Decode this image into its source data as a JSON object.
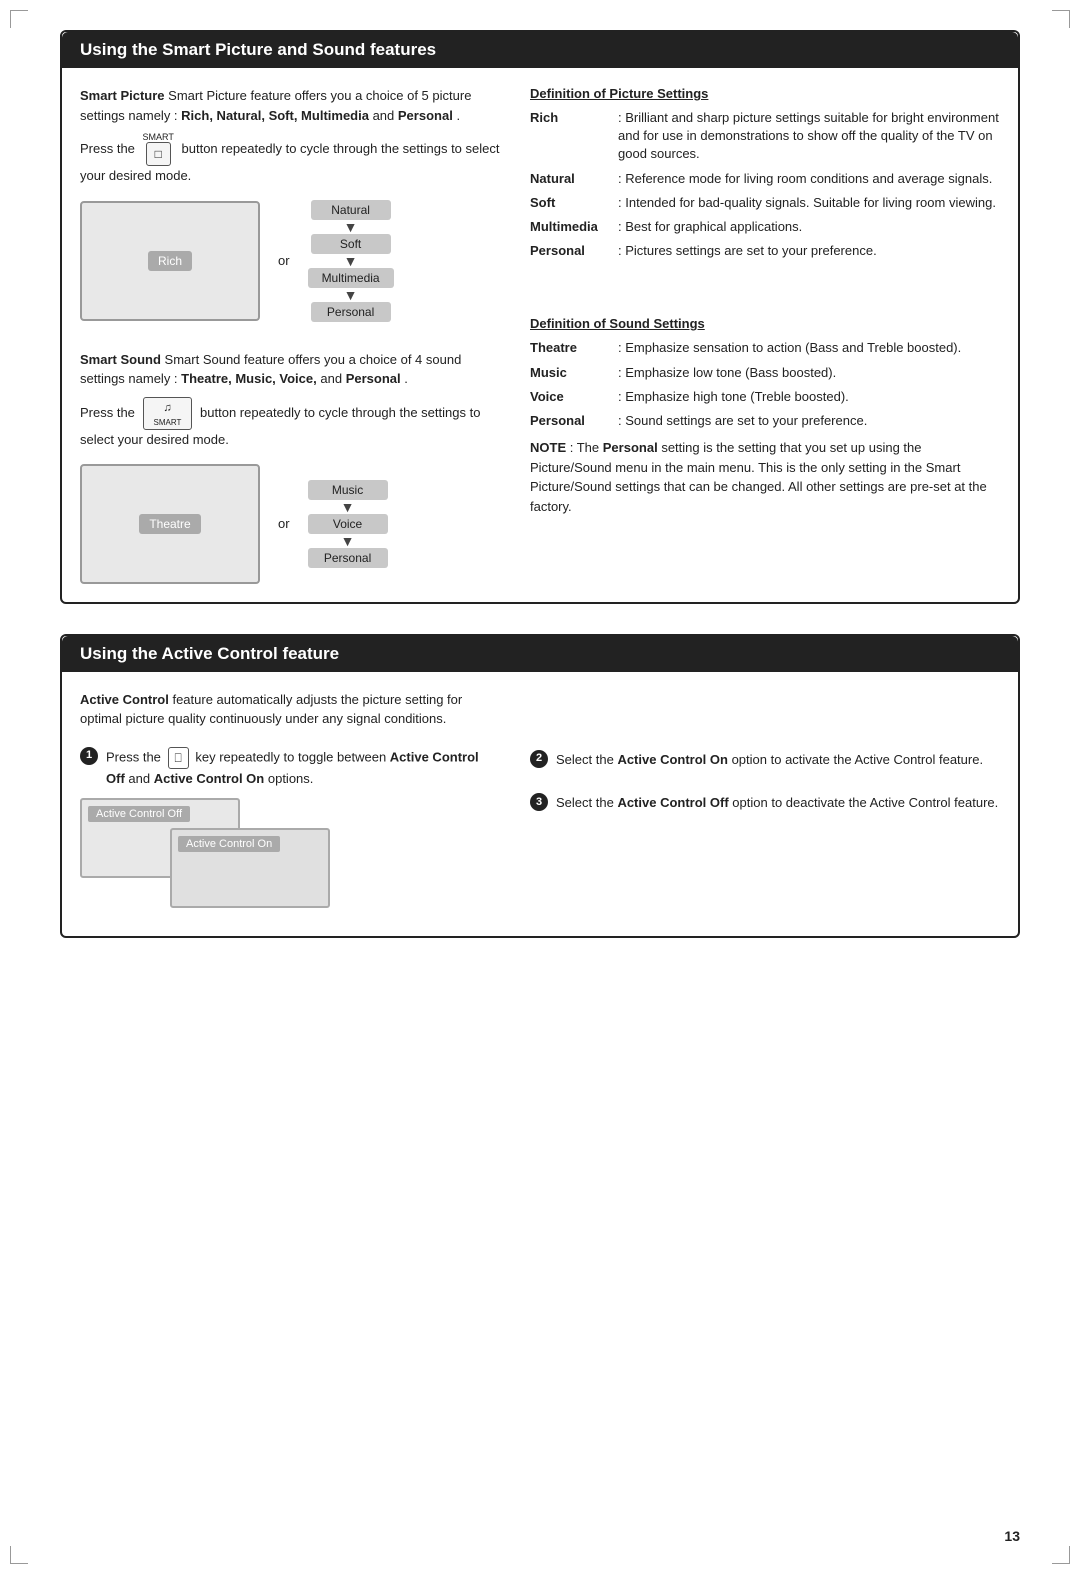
{
  "page": {
    "number": "13"
  },
  "section1": {
    "title": "Using the Smart Picture and Sound features",
    "left": {
      "smart_picture_intro": "Smart Picture feature offers you a choice of 5 picture settings namely : ",
      "smart_picture_bold": "Rich, Natural, Soft, Multimedia",
      "smart_picture_and": " and ",
      "smart_picture_personal": "Personal",
      "smart_picture_end": ".",
      "press_text": "Press the",
      "button_label": "button repeatedly to cycle through the settings to select your desired mode.",
      "smart_word": "SMART",
      "tv_label": "Rich",
      "or_text": "or",
      "cycle_items": [
        "Natural",
        "Soft",
        "Multimedia",
        "Personal"
      ],
      "smart_sound_intro": "Smart Sound feature offers you a choice of 4 sound settings namely : ",
      "smart_sound_bold": "Theatre, Music, Voice,",
      "smart_sound_and": " and ",
      "smart_sound_personal": "Personal",
      "smart_sound_end": ".",
      "press_text2": "Press the",
      "button_label2": "button repeatedly to cycle through the settings to select your desired mode.",
      "smart_word2": "SMART",
      "tv_label2": "Theatre",
      "or_text2": "or",
      "cycle_items2": [
        "Music",
        "Voice",
        "Personal"
      ]
    },
    "right": {
      "pic_def_title": "Definition of Picture Settings",
      "pic_definitions": [
        {
          "term": "Rich",
          "colon": ":",
          "desc": "Brilliant and sharp picture settings suitable for bright environment and for use in demonstrations to show off the quality of the TV on good sources."
        },
        {
          "term": "Natural",
          "colon": ":",
          "desc": "Reference mode for living room conditions and average signals."
        },
        {
          "term": "Soft",
          "colon": ":",
          "desc": "Intended for bad-quality signals. Suitable for living room viewing."
        },
        {
          "term": "Multimedia",
          "colon": ":",
          "desc": "Best for graphical applications."
        },
        {
          "term": "Personal",
          "colon": ":",
          "desc": "Pictures settings are set to your preference."
        }
      ],
      "sound_def_title": "Definition of Sound Settings",
      "sound_definitions": [
        {
          "term": "Theatre",
          "colon": ":",
          "desc": "Emphasize sensation to action (Bass and Treble boosted)."
        },
        {
          "term": "Music",
          "colon": ":",
          "desc": "Emphasize low tone (Bass boosted)."
        },
        {
          "term": "Voice",
          "colon": ":",
          "desc": "Emphasize high tone (Treble boosted)."
        },
        {
          "term": "Personal",
          "colon": ":",
          "desc": "Sound settings are set to your preference."
        }
      ],
      "note_label": "NOTE",
      "note_bold": "Personal",
      "note_text1": " : The ",
      "note_text2": " setting is the setting that you set up using the Picture/Sound menu in the main menu. This is the only setting in the Smart Picture/Sound settings that can be changed. All other settings are pre-set at the factory."
    }
  },
  "section2": {
    "title": "Using the Active Control feature",
    "left": {
      "intro_bold": "Active Control",
      "intro_text": " feature automatically adjusts the picture setting for optimal picture quality continuously under any signal conditions.",
      "step1_num": "1",
      "step1_text1": "Press the",
      "step1_text2": "key repeatedly to toggle between ",
      "step1_bold1": "Active Control Off",
      "step1_text3": " and ",
      "step1_bold2": "Active Control On",
      "step1_text4": " options.",
      "ac_tag1": "Active Control Off",
      "ac_tag2": "Active Control On"
    },
    "right": {
      "step2_num": "2",
      "step2_text1": "Select the ",
      "step2_bold": "Active Control On",
      "step2_text2": " option to activate the Active Control feature.",
      "step3_num": "3",
      "step3_text1": "Select the ",
      "step3_bold": "Active Control Off",
      "step3_text2": " option to deactivate the Active Control feature."
    }
  }
}
